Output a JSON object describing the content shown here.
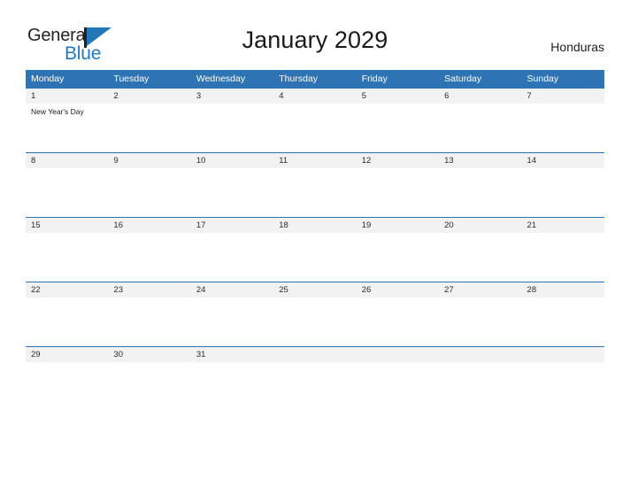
{
  "brand": {
    "name_part1": "General",
    "name_part2": "Blue",
    "flag_icon": "blue-triangle-flag-icon"
  },
  "header": {
    "title": "January 2029",
    "country": "Honduras"
  },
  "colors": {
    "header_blue": "#2e74b5",
    "logo_blue": "#1f7ac4",
    "date_band": "#f2f2f2",
    "page_background": "#ffffff"
  },
  "calendar": {
    "weekday_headers": [
      "Monday",
      "Tuesday",
      "Wednesday",
      "Thursday",
      "Friday",
      "Saturday",
      "Sunday"
    ],
    "weeks": [
      {
        "days": [
          {
            "date": "1",
            "events": [
              "New Year's Day"
            ]
          },
          {
            "date": "2",
            "events": []
          },
          {
            "date": "3",
            "events": []
          },
          {
            "date": "4",
            "events": []
          },
          {
            "date": "5",
            "events": []
          },
          {
            "date": "6",
            "events": []
          },
          {
            "date": "7",
            "events": []
          }
        ]
      },
      {
        "days": [
          {
            "date": "8",
            "events": []
          },
          {
            "date": "9",
            "events": []
          },
          {
            "date": "10",
            "events": []
          },
          {
            "date": "11",
            "events": []
          },
          {
            "date": "12",
            "events": []
          },
          {
            "date": "13",
            "events": []
          },
          {
            "date": "14",
            "events": []
          }
        ]
      },
      {
        "days": [
          {
            "date": "15",
            "events": []
          },
          {
            "date": "16",
            "events": []
          },
          {
            "date": "17",
            "events": []
          },
          {
            "date": "18",
            "events": []
          },
          {
            "date": "19",
            "events": []
          },
          {
            "date": "20",
            "events": []
          },
          {
            "date": "21",
            "events": []
          }
        ]
      },
      {
        "days": [
          {
            "date": "22",
            "events": []
          },
          {
            "date": "23",
            "events": []
          },
          {
            "date": "24",
            "events": []
          },
          {
            "date": "25",
            "events": []
          },
          {
            "date": "26",
            "events": []
          },
          {
            "date": "27",
            "events": []
          },
          {
            "date": "28",
            "events": []
          }
        ]
      },
      {
        "days": [
          {
            "date": "29",
            "events": []
          },
          {
            "date": "30",
            "events": []
          },
          {
            "date": "31",
            "events": []
          },
          {
            "date": "",
            "events": []
          },
          {
            "date": "",
            "events": []
          },
          {
            "date": "",
            "events": []
          },
          {
            "date": "",
            "events": []
          }
        ]
      }
    ]
  }
}
